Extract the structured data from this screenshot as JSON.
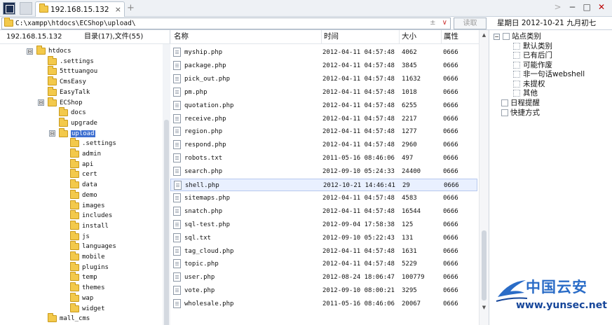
{
  "tab": {
    "label": "192.168.15.132",
    "close": "×",
    "add": "+"
  },
  "window_controls": {
    "back": ">",
    "minimize": "−",
    "maximize": "□",
    "close": "✕"
  },
  "address": {
    "path": "C:\\xampp\\htdocs\\ECShop\\upload\\",
    "actions": "±",
    "dropdown": "∨",
    "read_button": "读取"
  },
  "date_info": "星期日 2012-10-21 九月初七",
  "left_header": {
    "host": "192.168.15.132",
    "counts": "目录(17),文件(55)"
  },
  "tree": [
    {
      "label": "htdocs",
      "depth": 0,
      "expander": "⊟"
    },
    {
      "label": ".settings",
      "depth": 1,
      "expander": ""
    },
    {
      "label": "5tttuangou",
      "depth": 1,
      "expander": ""
    },
    {
      "label": "CmsEasy",
      "depth": 1,
      "expander": ""
    },
    {
      "label": "EasyTalk",
      "depth": 1,
      "expander": ""
    },
    {
      "label": "ECShop",
      "depth": 1,
      "expander": "⊟"
    },
    {
      "label": "docs",
      "depth": 2,
      "expander": ""
    },
    {
      "label": "upgrade",
      "depth": 2,
      "expander": ""
    },
    {
      "label": "upload",
      "depth": 2,
      "expander": "⊟",
      "selected": true
    },
    {
      "label": ".settings",
      "depth": 3,
      "expander": ""
    },
    {
      "label": "admin",
      "depth": 3,
      "expander": ""
    },
    {
      "label": "api",
      "depth": 3,
      "expander": ""
    },
    {
      "label": "cert",
      "depth": 3,
      "expander": ""
    },
    {
      "label": "data",
      "depth": 3,
      "expander": ""
    },
    {
      "label": "demo",
      "depth": 3,
      "expander": ""
    },
    {
      "label": "images",
      "depth": 3,
      "expander": ""
    },
    {
      "label": "includes",
      "depth": 3,
      "expander": ""
    },
    {
      "label": "install",
      "depth": 3,
      "expander": ""
    },
    {
      "label": "js",
      "depth": 3,
      "expander": ""
    },
    {
      "label": "languages",
      "depth": 3,
      "expander": ""
    },
    {
      "label": "mobile",
      "depth": 3,
      "expander": ""
    },
    {
      "label": "plugins",
      "depth": 3,
      "expander": ""
    },
    {
      "label": "temp",
      "depth": 3,
      "expander": ""
    },
    {
      "label": "themes",
      "depth": 3,
      "expander": ""
    },
    {
      "label": "wap",
      "depth": 3,
      "expander": ""
    },
    {
      "label": "widget",
      "depth": 3,
      "expander": ""
    },
    {
      "label": "mall_cms",
      "depth": 1,
      "expander": ""
    }
  ],
  "file_columns": {
    "name": "名称",
    "time": "时间",
    "size": "大小",
    "attr": "属性"
  },
  "files": [
    {
      "name": "myship.php",
      "time": "2012-04-11 04:57:48",
      "size": "4062",
      "attr": "0666"
    },
    {
      "name": "package.php",
      "time": "2012-04-11 04:57:48",
      "size": "3845",
      "attr": "0666"
    },
    {
      "name": "pick_out.php",
      "time": "2012-04-11 04:57:48",
      "size": "11632",
      "attr": "0666"
    },
    {
      "name": "pm.php",
      "time": "2012-04-11 04:57:48",
      "size": "1018",
      "attr": "0666"
    },
    {
      "name": "quotation.php",
      "time": "2012-04-11 04:57:48",
      "size": "6255",
      "attr": "0666"
    },
    {
      "name": "receive.php",
      "time": "2012-04-11 04:57:48",
      "size": "2217",
      "attr": "0666"
    },
    {
      "name": "region.php",
      "time": "2012-04-11 04:57:48",
      "size": "1277",
      "attr": "0666"
    },
    {
      "name": "respond.php",
      "time": "2012-04-11 04:57:48",
      "size": "2960",
      "attr": "0666"
    },
    {
      "name": "robots.txt",
      "time": "2011-05-16 08:46:06",
      "size": "497",
      "attr": "0666"
    },
    {
      "name": "search.php",
      "time": "2012-09-10 05:24:33",
      "size": "24400",
      "attr": "0666"
    },
    {
      "name": "shell.php",
      "time": "2012-10-21 14:46:41",
      "size": "29",
      "attr": "0666",
      "selected": true
    },
    {
      "name": "sitemaps.php",
      "time": "2012-04-11 04:57:48",
      "size": "4583",
      "attr": "0666"
    },
    {
      "name": "snatch.php",
      "time": "2012-04-11 04:57:48",
      "size": "16544",
      "attr": "0666"
    },
    {
      "name": "sql-test.php",
      "time": "2012-09-04 17:58:38",
      "size": "125",
      "attr": "0666"
    },
    {
      "name": "sql.txt",
      "time": "2012-09-10 05:22:43",
      "size": "131",
      "attr": "0666"
    },
    {
      "name": "tag_cloud.php",
      "time": "2012-04-11 04:57:48",
      "size": "1631",
      "attr": "0666"
    },
    {
      "name": "topic.php",
      "time": "2012-04-11 04:57:48",
      "size": "5229",
      "attr": "0666"
    },
    {
      "name": "user.php",
      "time": "2012-08-24 18:06:47",
      "size": "100779",
      "attr": "0666"
    },
    {
      "name": "vote.php",
      "time": "2012-09-10 08:00:21",
      "size": "3295",
      "attr": "0666"
    },
    {
      "name": "wholesale.php",
      "time": "2011-05-16 08:46:06",
      "size": "20067",
      "attr": "0666"
    }
  ],
  "right_panel": {
    "root": "站点类别",
    "categories": [
      "默认类别",
      "已有后门",
      "可能作废",
      "非一句话webshell",
      "未提权",
      "其他"
    ],
    "schedule": "日程提醒",
    "shortcuts": "快捷方式"
  },
  "watermark": {
    "cn": "中国云安",
    "url": "www.yunsec.net"
  },
  "colors": {
    "selection": "#3d6fd1",
    "folder": "#f3c94b",
    "brand": "#2a6cc7"
  }
}
